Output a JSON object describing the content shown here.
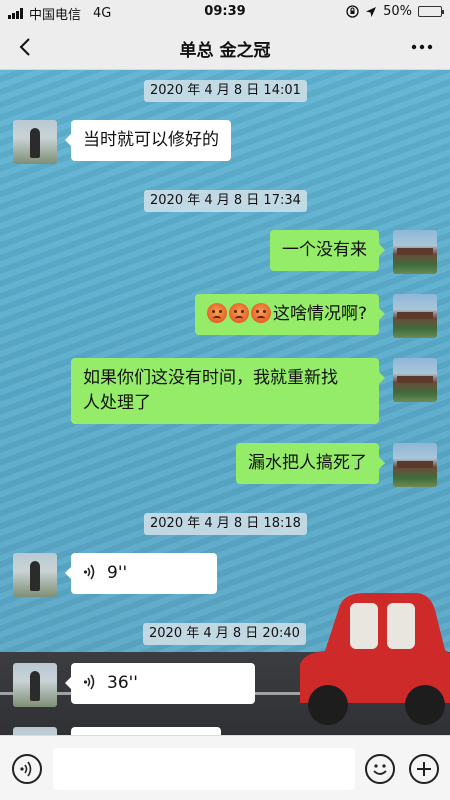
{
  "status": {
    "carrier": "中国电信",
    "network": "4G",
    "time": "09:39",
    "battery": "50%",
    "battery_level": 0.5
  },
  "nav": {
    "title": "单总  金之冠"
  },
  "messages": {
    "t1": "2020 年 4 月 8 日 14:01",
    "m1": "当时就可以修好的",
    "t2": "2020 年 4 月 8 日 17:34",
    "m2": "一个没有来",
    "m3": "这啥情况啊?",
    "m4_line1": "如果你们这没有时间，我就重新找",
    "m4_line2": "人处理了",
    "m5": "漏水把人搞死了",
    "t3": "2020 年 4 月 8 日 18:18",
    "v1": "9''",
    "t4": "2020 年 4 月 8 日 20:40",
    "v2": "36''"
  },
  "icons": {
    "back": "chevron-left-icon",
    "more": "more-dots-icon",
    "voice": "voice-icon",
    "emoji": "emoji-icon",
    "plus": "plus-icon",
    "angry": "angry-face-emoji"
  },
  "colors": {
    "sent_bubble": "#95ec69",
    "received_bubble": "#ffffff",
    "battery": "#f5c518"
  }
}
